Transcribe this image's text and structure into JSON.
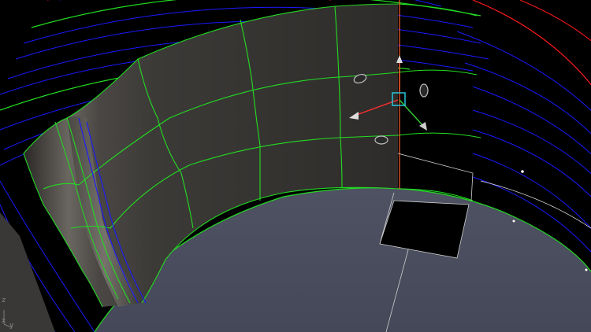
{
  "viewport": {
    "background": "#000000",
    "colors": {
      "wireframe_green": "#22dd22",
      "curve_blue": "#1a1aff",
      "curve_red": "#ff1a1a",
      "floor": "#474c5c",
      "surface": "#3a3836",
      "gizmo_x": "#ff3030",
      "gizmo_y": "#33cc33",
      "gizmo_z": "#ff6030",
      "gizmo_box": "#26c6da"
    },
    "axis_indicator": {
      "z": "z",
      "x": "x",
      "y": "y"
    },
    "gizmo_icon": "transform-gizmo-icon"
  }
}
